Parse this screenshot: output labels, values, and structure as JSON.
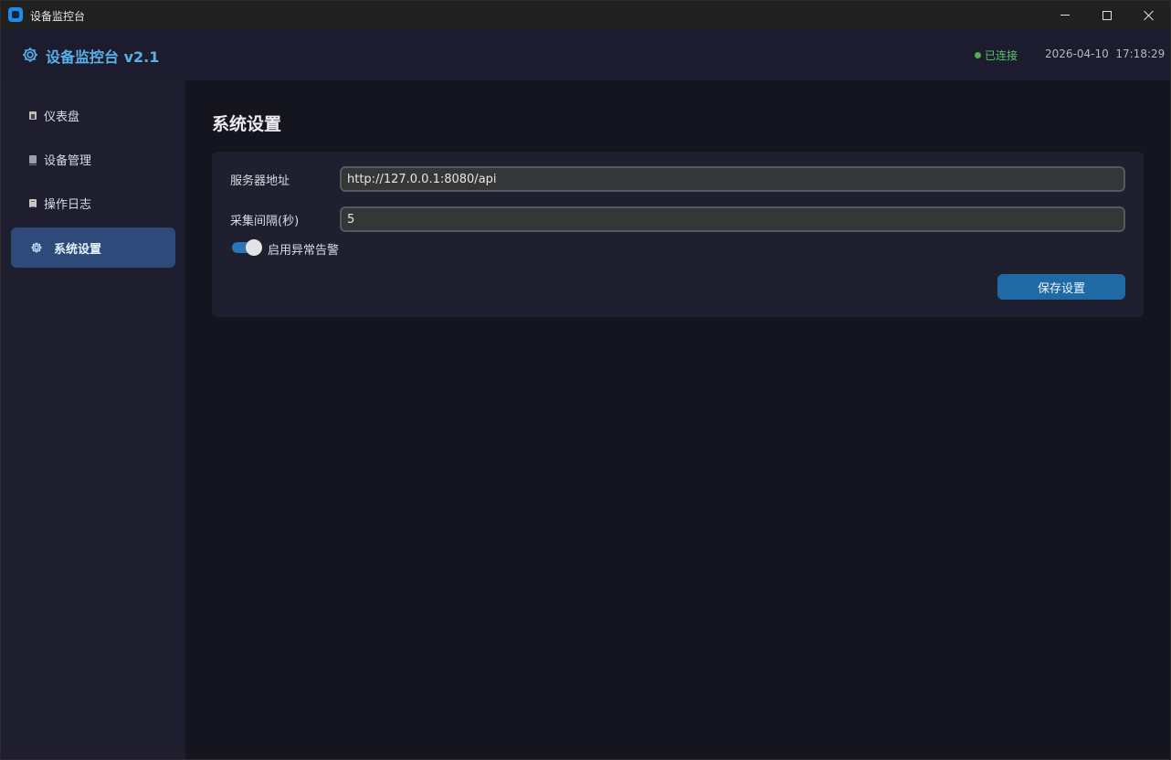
{
  "window": {
    "title": "设备监控台"
  },
  "header": {
    "title": "设备监控台 v2.1",
    "status": "已连接",
    "datetime": "2026-04-10  17:18:29"
  },
  "sidebar": {
    "items": [
      {
        "label": "仪表盘",
        "icon": "chart-icon"
      },
      {
        "label": "设备管理",
        "icon": "device-icon"
      },
      {
        "label": "操作日志",
        "icon": "log-icon"
      },
      {
        "label": "系统设置",
        "icon": "gear-icon",
        "active": true
      }
    ]
  },
  "main": {
    "page_title": "系统设置",
    "settings": {
      "server_label": "服务器地址",
      "server_value": "http://127.0.0.1:8080/api",
      "interval_label": "采集间隔(秒)",
      "interval_value": "5",
      "alert_toggle_label": "启用异常告警",
      "alert_enabled": true,
      "save_label": "保存设置"
    }
  },
  "colors": {
    "accent": "#1f6aa5",
    "brand": "#58b2ea",
    "active_nav": "#2d4a7a",
    "status_ok": "#4caf50"
  }
}
